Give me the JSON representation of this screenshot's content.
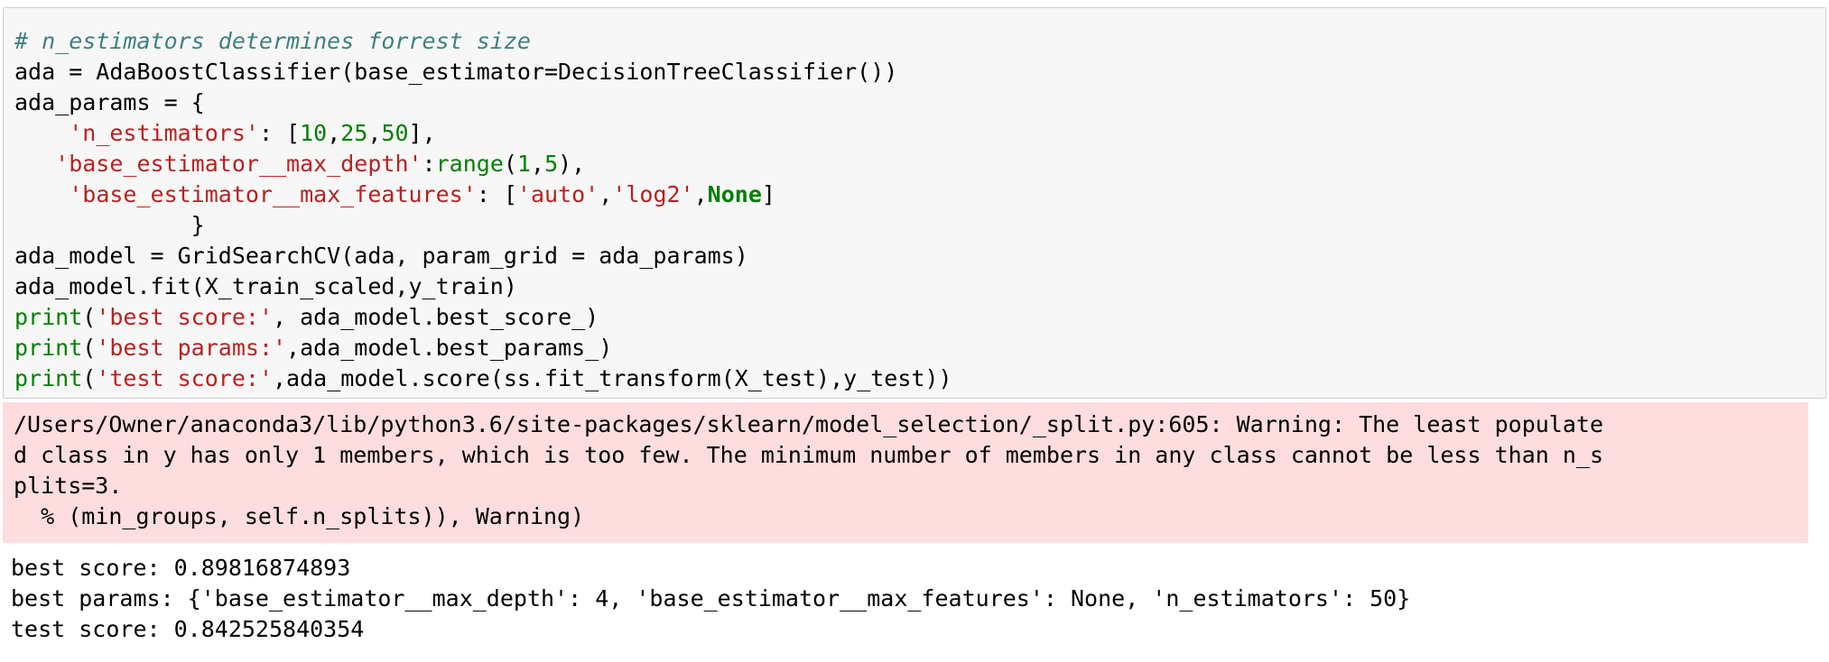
{
  "code_cell": {
    "lines": [
      [
        {
          "t": "# n_estimators determines forrest size",
          "k": "comment"
        }
      ],
      [
        {
          "t": "ada = AdaBoostClassifier(base_estimator=DecisionTreeClassifier())",
          "k": "plain"
        }
      ],
      [
        {
          "t": "ada_params = {",
          "k": "plain"
        }
      ],
      [
        {
          "t": "    ",
          "k": "plain"
        },
        {
          "t": "'n_estimators'",
          "k": "string"
        },
        {
          "t": ": [",
          "k": "plain"
        },
        {
          "t": "10",
          "k": "number"
        },
        {
          "t": ",",
          "k": "plain"
        },
        {
          "t": "25",
          "k": "number"
        },
        {
          "t": ",",
          "k": "plain"
        },
        {
          "t": "50",
          "k": "number"
        },
        {
          "t": "],",
          "k": "plain"
        }
      ],
      [
        {
          "t": "   ",
          "k": "plain"
        },
        {
          "t": "'base_estimator__max_depth'",
          "k": "string"
        },
        {
          "t": ":",
          "k": "plain"
        },
        {
          "t": "range",
          "k": "builtin"
        },
        {
          "t": "(",
          "k": "plain"
        },
        {
          "t": "1",
          "k": "number"
        },
        {
          "t": ",",
          "k": "plain"
        },
        {
          "t": "5",
          "k": "number"
        },
        {
          "t": "),",
          "k": "plain"
        }
      ],
      [
        {
          "t": "    ",
          "k": "plain"
        },
        {
          "t": "'base_estimator__max_features'",
          "k": "string"
        },
        {
          "t": ": [",
          "k": "plain"
        },
        {
          "t": "'auto'",
          "k": "string"
        },
        {
          "t": ",",
          "k": "plain"
        },
        {
          "t": "'log2'",
          "k": "string"
        },
        {
          "t": ",",
          "k": "plain"
        },
        {
          "t": "None",
          "k": "keyword"
        },
        {
          "t": "]",
          "k": "plain"
        }
      ],
      [
        {
          "t": "             }",
          "k": "plain"
        }
      ],
      [
        {
          "t": "ada_model = GridSearchCV(ada, param_grid = ada_params)",
          "k": "plain"
        }
      ],
      [
        {
          "t": "ada_model.fit(X_train_scaled,y_train)",
          "k": "plain"
        }
      ],
      [
        {
          "t": "print",
          "k": "builtin"
        },
        {
          "t": "(",
          "k": "plain"
        },
        {
          "t": "'best score:'",
          "k": "string"
        },
        {
          "t": ", ada_model.best_score_)",
          "k": "plain"
        }
      ],
      [
        {
          "t": "print",
          "k": "builtin"
        },
        {
          "t": "(",
          "k": "plain"
        },
        {
          "t": "'best params:'",
          "k": "string"
        },
        {
          "t": ",ada_model.best_params_)",
          "k": "plain"
        }
      ],
      [
        {
          "t": "print",
          "k": "builtin"
        },
        {
          "t": "(",
          "k": "plain"
        },
        {
          "t": "'test score:'",
          "k": "string"
        },
        {
          "t": ",ada_model.score(ss.fit_transform(X_test),y_test))",
          "k": "plain"
        }
      ]
    ]
  },
  "stderr": {
    "lines": [
      "/Users/Owner/anaconda3/lib/python3.6/site-packages/sklearn/model_selection/_split.py:605: Warning: The least populate",
      "d class in y has only 1 members, which is too few. The minimum number of members in any class cannot be less than n_s",
      "plits=3.",
      "  % (min_groups, self.n_splits)), Warning)"
    ]
  },
  "stdout": {
    "lines": [
      "best score: 0.89816874893",
      "best params: {'base_estimator__max_depth': 4, 'base_estimator__max_features': None, 'n_estimators': 50}",
      "test score: 0.842525840354"
    ]
  },
  "colors": {
    "code_background": "#f7f7f7",
    "stderr_background": "#fddddd",
    "comment": "#408080",
    "string": "#ba2121",
    "number": "#008000",
    "builtin": "#008000",
    "keyword": "#008000"
  }
}
